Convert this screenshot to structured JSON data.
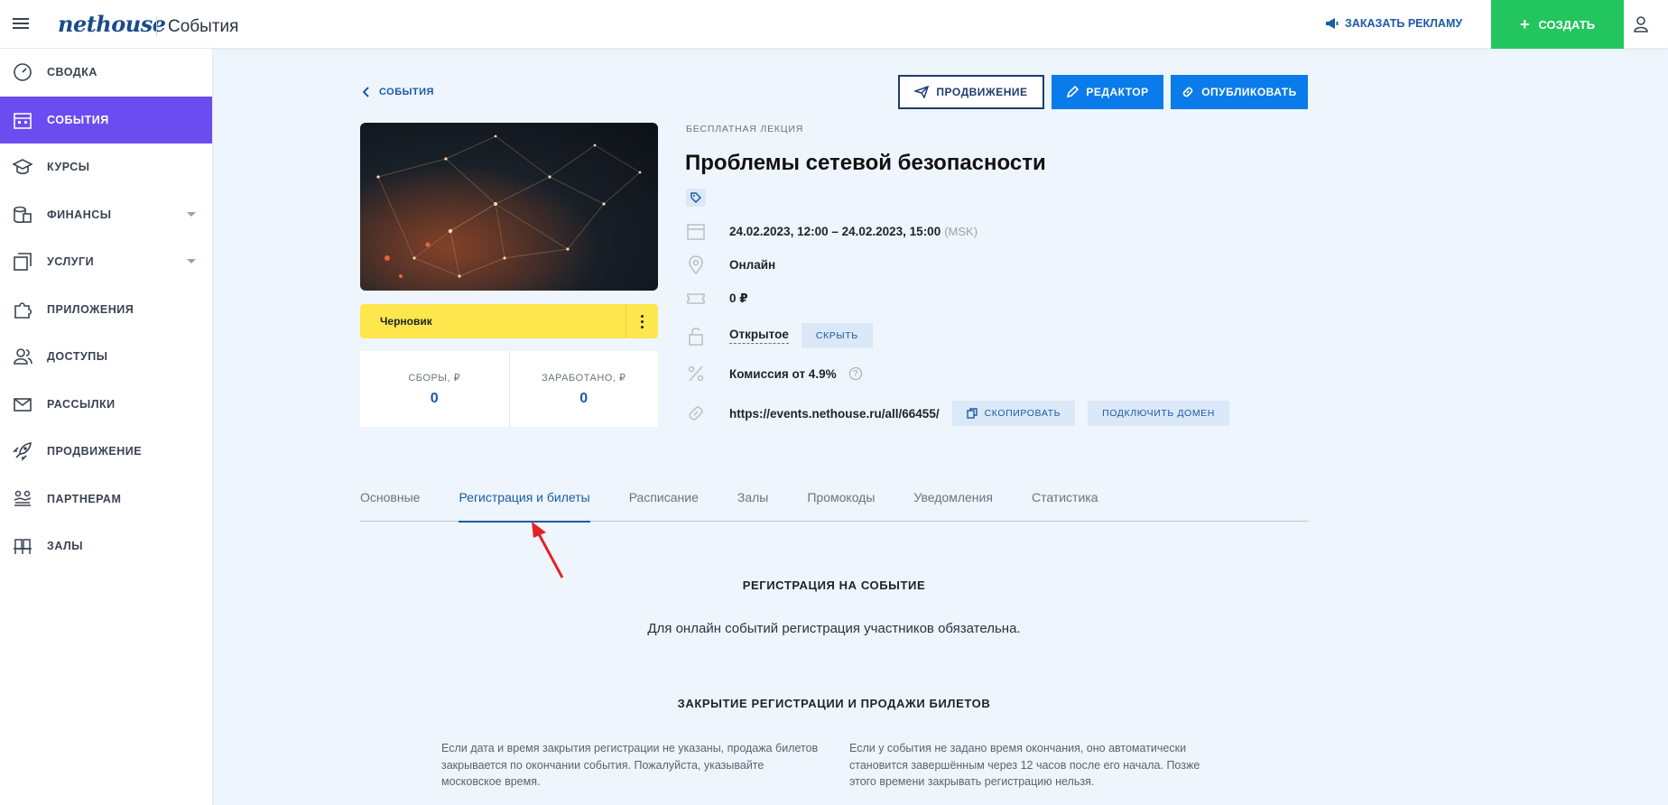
{
  "header": {
    "logo": "nethouse",
    "section_title": "События",
    "ad_link": "ЗАКАЗАТЬ РЕКЛАМУ",
    "create_button": "СОЗДАТЬ"
  },
  "sidebar": {
    "items": [
      {
        "label": "СВОДКА",
        "icon": "dashboard-icon",
        "active": false
      },
      {
        "label": "СОБЫТИЯ",
        "icon": "calendar-icon",
        "active": true
      },
      {
        "label": "КУРСЫ",
        "icon": "graduation-cap-icon",
        "active": false
      },
      {
        "label": "ФИНАНСЫ",
        "icon": "coins-icon",
        "active": false,
        "expandable": true
      },
      {
        "label": "УСЛУГИ",
        "icon": "services-icon",
        "active": false,
        "expandable": true
      },
      {
        "label": "ПРИЛОЖЕНИЯ",
        "icon": "puzzle-icon",
        "active": false
      },
      {
        "label": "ДОСТУПЫ",
        "icon": "users-icon",
        "active": false
      },
      {
        "label": "РАССЫЛКИ",
        "icon": "mail-icon",
        "active": false
      },
      {
        "label": "ПРОДВИЖЕНИЕ",
        "icon": "rocket-icon",
        "active": false
      },
      {
        "label": "ПАРТНЕРАМ",
        "icon": "handshake-icon",
        "active": false
      },
      {
        "label": "ЗАЛЫ",
        "icon": "seats-icon",
        "active": false
      }
    ]
  },
  "toolbar": {
    "back_label": "СОБЫТИЯ",
    "promotion_label": "ПРОДВИЖЕНИЕ",
    "editor_label": "РЕДАКТОР",
    "publish_label": "ОПУБЛИКОВАТЬ"
  },
  "event": {
    "type": "БЕСПЛАТНАЯ ЛЕКЦИЯ",
    "title": "Проблемы сетевой безопасности",
    "status": "Черновик",
    "datetime": "24.02.2023, 12:00 – 24.02.2023, 15:00",
    "timezone": "(MSK)",
    "location": "Онлайн",
    "price": "0 ₽",
    "visibility": "Открытое",
    "hide_label": "СКРЫТЬ",
    "commission": "Комиссия от 4.9%",
    "url": "https://events.nethouse.ru/all/66455/",
    "copy_label": "СКОПИРОВАТЬ",
    "domain_label": "ПОДКЛЮЧИТЬ ДОМЕН"
  },
  "stats": {
    "collected_label": "СБОРЫ, ₽",
    "collected_value": "0",
    "earned_label": "ЗАРАБОТАНО, ₽",
    "earned_value": "0"
  },
  "tabs": [
    {
      "label": "Основные",
      "active": false
    },
    {
      "label": "Регистрация и билеты",
      "active": true
    },
    {
      "label": "Расписание",
      "active": false
    },
    {
      "label": "Залы",
      "active": false
    },
    {
      "label": "Промокоды",
      "active": false
    },
    {
      "label": "Уведомления",
      "active": false
    },
    {
      "label": "Статистика",
      "active": false
    }
  ],
  "registration": {
    "heading": "РЕГИСТРАЦИЯ НА СОБЫТИЕ",
    "text": "Для онлайн событий регистрация участников обязательна.",
    "closing_heading": "ЗАКРЫТИЕ РЕГИСТРАЦИИ И ПРОДАЖИ БИЛЕТОВ",
    "left_note": "Если дата и время закрытия регистрации не указаны, продажа билетов закрывается по окончании события. Пожалуйста, указывайте московское время.",
    "right_note": "Если у события не задано время окончания, оно автоматически становится завершённым через 12 часов после его начала. Позже этого времени закрывать регистрацию нельзя."
  },
  "colors": {
    "accent_purple": "#6a4cf0",
    "create_green": "#22c55e",
    "primary_blue": "#0a7bea",
    "draft_yellow": "#fde74c",
    "annotation_red": "#e02424"
  }
}
